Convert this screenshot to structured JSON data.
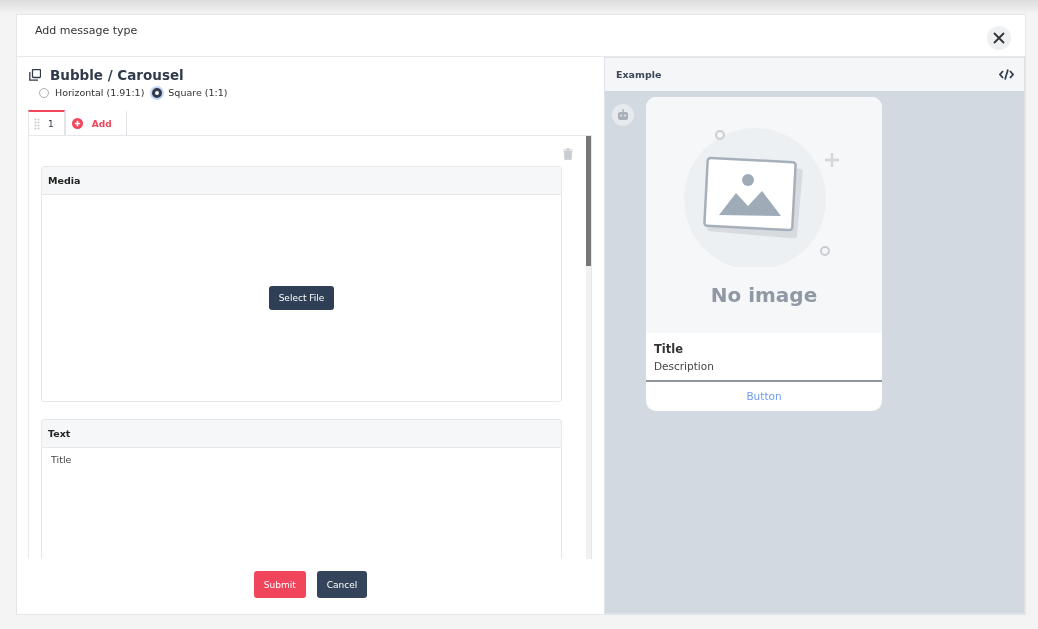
{
  "dialog": {
    "title": "Add message type"
  },
  "section": {
    "title": "Bubble / Carousel"
  },
  "ratio_options": [
    {
      "label": "Horizontal (1.91:1)",
      "selected": false
    },
    {
      "label": "Square (1:1)",
      "selected": true
    }
  ],
  "tabs": [
    {
      "label": "1",
      "selected": true,
      "kind": "page"
    },
    {
      "label": "Add",
      "selected": false,
      "kind": "add"
    }
  ],
  "media": {
    "heading": "Media",
    "button": "Select File"
  },
  "text": {
    "heading": "Text",
    "placeholder": "Title"
  },
  "buttons": [
    {
      "label": "Submit",
      "kind": "primary"
    },
    {
      "label": "Cancel",
      "kind": "secondary"
    }
  ],
  "preview": {
    "heading": "Example",
    "image_text": "No image",
    "card_title": "Title",
    "card_description": "Description",
    "card_button": "Button"
  }
}
